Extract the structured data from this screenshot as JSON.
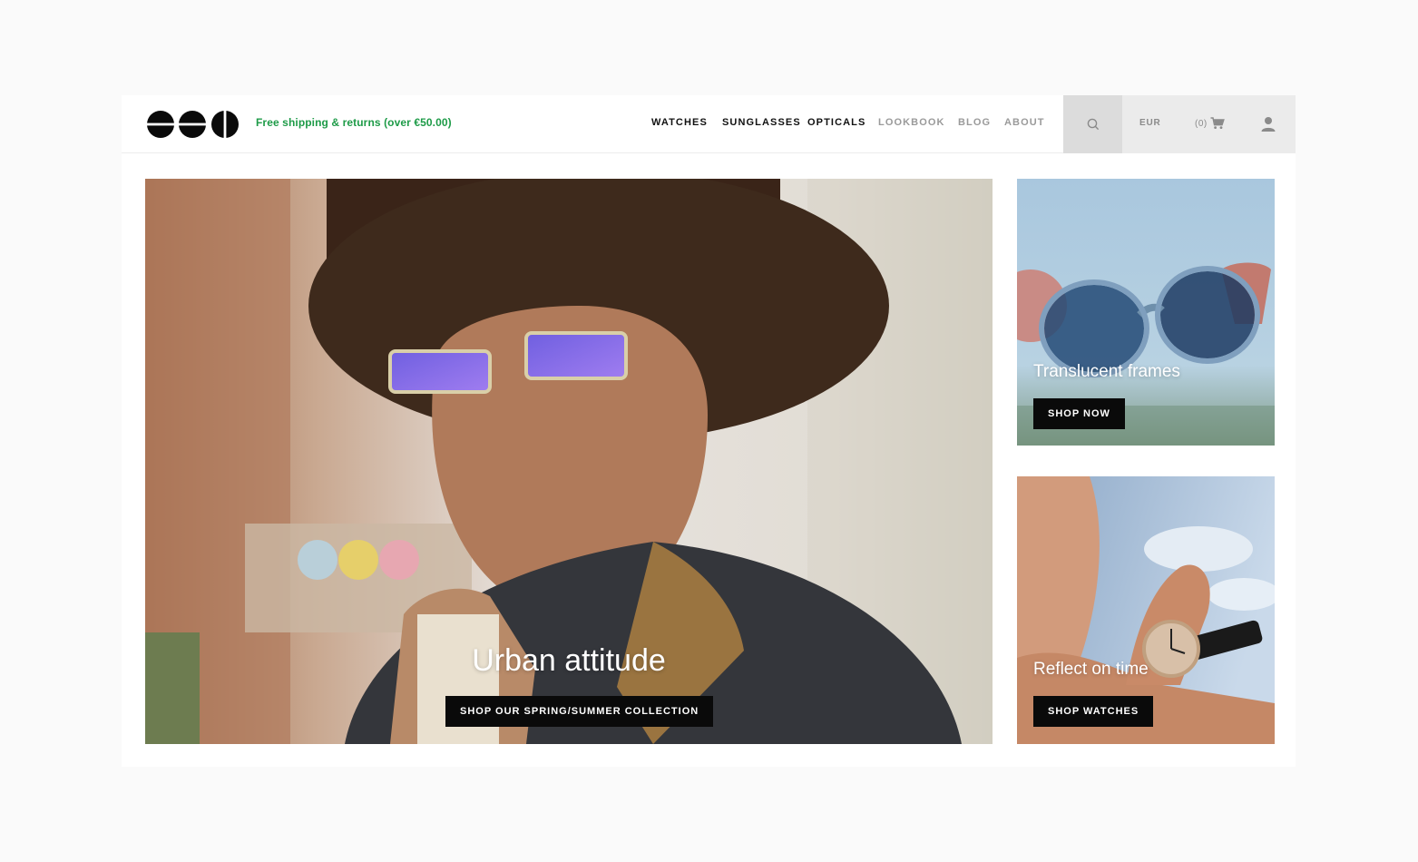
{
  "header": {
    "logo_icon": "brand-logo-three-circles",
    "promo": "Free shipping & returns (over €50.00)",
    "promo_color": "#1e9b48",
    "nav": [
      {
        "label": "WATCHES",
        "active": true
      },
      {
        "label": "SUNGLASSES",
        "active": true
      },
      {
        "label": "OPTICALS",
        "active": true
      },
      {
        "label": "LOOKBOOK",
        "active": false
      },
      {
        "label": "BLOG",
        "active": false
      },
      {
        "label": "ABOUT",
        "active": false
      }
    ],
    "tools": {
      "search_icon": "search-icon",
      "currency": "EUR",
      "cart_count": "(0)",
      "cart_icon": "cart-icon",
      "account_icon": "user-icon"
    }
  },
  "tiles": {
    "hero": {
      "title": "Urban attitude",
      "button": "SHOP OUR SPRING/SUMMER COLLECTION"
    },
    "translucent": {
      "title": "Translucent frames",
      "button": "SHOP NOW"
    },
    "watches": {
      "title": "Reflect on time",
      "button": "SHOP WATCHES"
    }
  },
  "colors": {
    "button_bg": "#0a0a0a",
    "page_bg": "#fafafa",
    "tools_bg": "#ebebeb"
  }
}
